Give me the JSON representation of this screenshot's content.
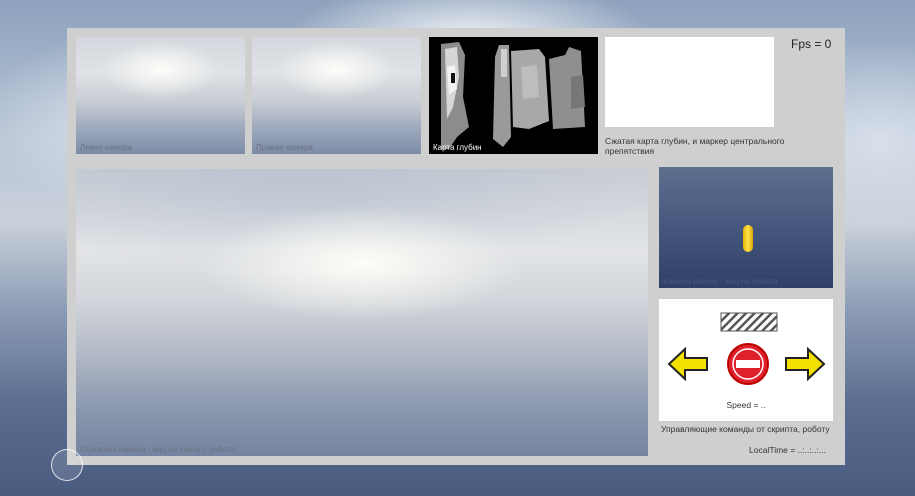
{
  "fps_label": "Fps = 0",
  "cameras": {
    "left_caption": "Левая камера",
    "right_caption": "Правая камера",
    "depth_caption": "Карта глубин",
    "main_caption": "Основная камера - вид на сцену с робота",
    "top_caption": "Камера сверху - вид на робота"
  },
  "compressed_depth": {
    "caption": "Сжатая карта глубин, и маркер центрального препятствия"
  },
  "controls": {
    "speed_label": "Speed = ..",
    "caption": "Управляющие команды от скрипта, роботу",
    "left_arrow_icon": "left-arrow-icon",
    "stop_icon": "no-entry-icon",
    "right_arrow_icon": "right-arrow-icon",
    "forward_icon": "hatched-bar-icon",
    "arrow_color": "#f2e000",
    "stop_color": "#e0202a"
  },
  "local_time_label": "LocalTime = ..:..:..:..."
}
